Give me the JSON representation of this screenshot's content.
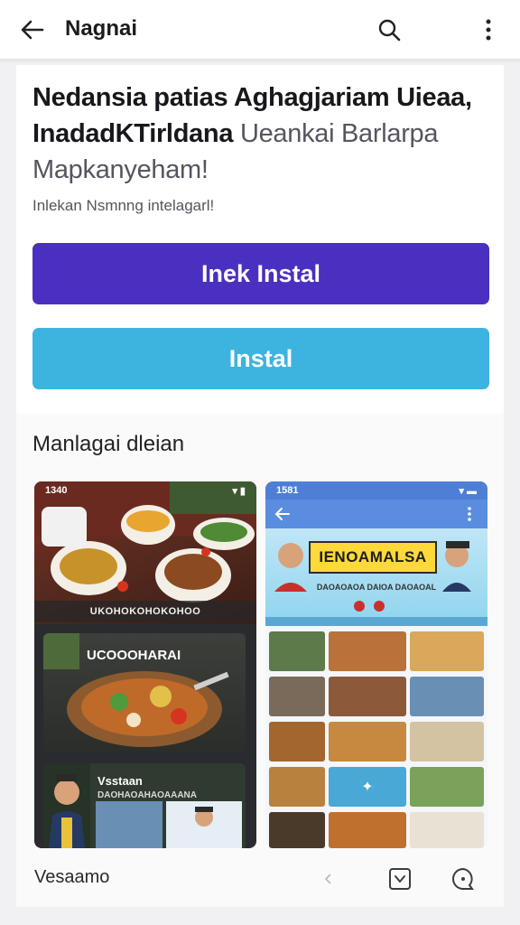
{
  "appbar": {
    "back_icon": "arrow-left-icon",
    "title": "Nagnai",
    "search_icon": "search-icon",
    "more_icon": "more-vertical-icon"
  },
  "headline": {
    "line1": "Nedansia  patias Aghagjariam Uieaa,",
    "line2_bold": "InadadKTirldana",
    "line2_soft": " Ueankai Barlarpa",
    "line3": "Mapkanyeham!"
  },
  "subline": "Inlekan Nsmnng intelagarl!",
  "buttons": {
    "primary": "Inek Instal",
    "secondary": "Instal"
  },
  "gallery": {
    "title": "Manlagai dleian",
    "left_screen": {
      "status_time": "1340",
      "caption": "UKOHOKOHOKOHOO",
      "mid_title": "UCOOOHARAI",
      "bottom_title": "Vsstaan",
      "bottom_subtitle": "DAOHAOAHAOAAANA"
    },
    "right_screen": {
      "status_time": "1581",
      "banner_title": "IENOAMALSA",
      "banner_subtitle": "DAOAOAOA    DAIOA    DAOAOAL"
    }
  },
  "bottom_row": {
    "label": "Vesaamo",
    "chevron_icon": "chevron-left-icon",
    "check_icon": "check-box-icon",
    "bubble_icon": "chat-bubble-icon"
  },
  "colors": {
    "primary_button": "#4b2fc0",
    "secondary_button": "#3cb4df",
    "background": "#f1f1f3"
  }
}
